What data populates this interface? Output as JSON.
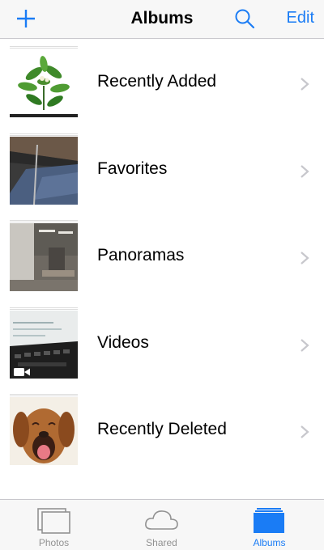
{
  "navbar": {
    "title": "Albums",
    "edit_label": "Edit",
    "plus_icon": "plus-icon",
    "search_icon": "search-icon"
  },
  "albums": [
    {
      "label": "Recently Added",
      "thumb": "green-plant"
    },
    {
      "label": "Favorites",
      "thumb": "desk-jeans"
    },
    {
      "label": "Panoramas",
      "thumb": "office-room"
    },
    {
      "label": "Videos",
      "thumb": "keyboard-screen",
      "badge": "video-camera-icon"
    },
    {
      "label": "Recently Deleted",
      "thumb": "puppy"
    }
  ],
  "tabbar": {
    "tabs": [
      {
        "label": "Photos",
        "icon": "photos-icon",
        "active": false
      },
      {
        "label": "Shared",
        "icon": "cloud-icon",
        "active": false
      },
      {
        "label": "Albums",
        "icon": "albums-icon",
        "active": true
      }
    ]
  },
  "colors": {
    "accent": "#1a7cf5",
    "inactive": "#929292",
    "bar_bg": "#f7f7f7"
  }
}
